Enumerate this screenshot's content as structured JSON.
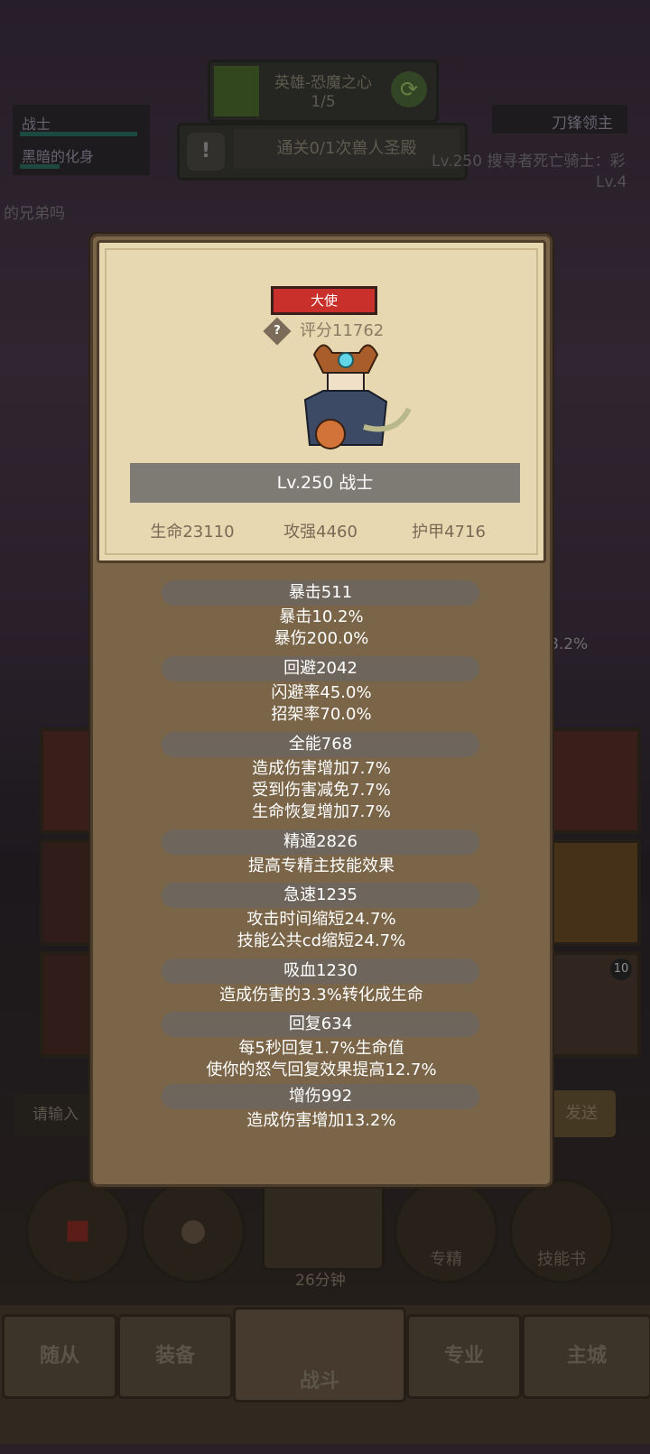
{
  "background": {
    "quest_title": "英雄-恐魔之心",
    "quest_progress": "1/5",
    "objective": "通关0/1次兽人圣殿",
    "party": [
      "战士",
      "黑暗的化身"
    ],
    "enemy_name": "刀锋领主",
    "enemy_info": "Lv.250 搜寻者死亡骑士：彩",
    "enemy_level_partial": "Lv.4",
    "chat_partial": "的兄弟吗",
    "stat_partial": "8.2%",
    "slot_badge": "10",
    "input_placeholder": "请输入",
    "send_label": "发送",
    "timer_label": "26分钟",
    "skill_labels": [
      "专精",
      "技能书"
    ],
    "nav_tabs": [
      "随从",
      "装备",
      "战斗",
      "专业",
      "主城"
    ]
  },
  "card": {
    "title_badge": "大使",
    "score_icon": "question-icon",
    "score": "评分11762",
    "level_name": "Lv.250 战士",
    "base_stats": [
      "生命23110",
      "攻强4460",
      "护甲4716"
    ],
    "stats": [
      {
        "head": "暴击511",
        "lines": [
          "暴击10.2%",
          "暴伤200.0%"
        ]
      },
      {
        "head": "回避2042",
        "lines": [
          "闪避率45.0%",
          "招架率70.0%"
        ]
      },
      {
        "head": "全能768",
        "lines": [
          "造成伤害增加7.7%",
          "受到伤害减免7.7%",
          "生命恢复增加7.7%"
        ]
      },
      {
        "head": "精通2826",
        "lines": [
          "提高专精主技能效果"
        ]
      },
      {
        "head": "急速1235",
        "lines": [
          "攻击时间缩短24.7%",
          "技能公共cd缩短24.7%"
        ]
      },
      {
        "head": "吸血1230",
        "lines": [
          "造成伤害的3.3%转化成生命"
        ]
      },
      {
        "head": "回复634",
        "lines": [
          "每5秒回复1.7%生命值",
          "使你的怒气回复效果提高12.7%"
        ]
      },
      {
        "head": "增伤992",
        "lines": [
          "造成伤害增加13.2%"
        ]
      }
    ]
  },
  "colors": {
    "badge_red": "#c9302c",
    "card_bg": "#7a6548",
    "parchment": "#e7d8b2"
  }
}
